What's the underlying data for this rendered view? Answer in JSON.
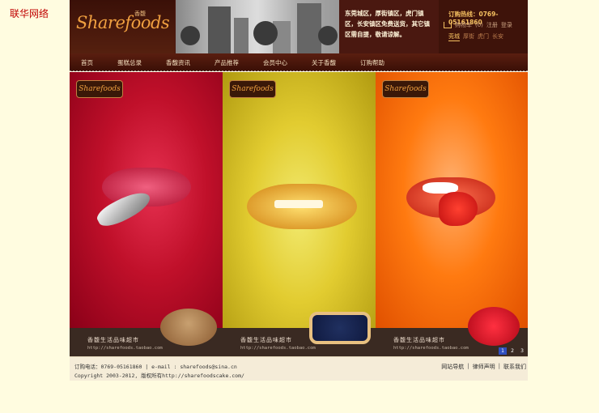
{
  "corner_label": "联华网络",
  "header": {
    "logo": "Sharefoods",
    "logo_cn": "香馥",
    "notice": "东莞城区，厚街镇区，虎门镇区，长安镇区免费送货，其它镇区需自提，敬请谅解。",
    "hotline_label": "订购热线：",
    "hotline": "0769-05161860",
    "cart": "购物车",
    "cart_count": "(0)",
    "register": "注册",
    "login": "登录",
    "cities": [
      "莞城",
      "厚街",
      "虎门",
      "长安"
    ],
    "active_city": "莞城"
  },
  "nav": {
    "items": [
      "首页",
      "蛋糕总录",
      "香馥资讯",
      "产品推荐",
      "会员中心",
      "关于香馥",
      "订购帮助"
    ]
  },
  "banner": {
    "panels": [
      {
        "logo": "Sharefoods",
        "slogan": "香馥生活品味超市",
        "url": "http://sharefoods.taobao.com"
      },
      {
        "logo": "Sharefoods",
        "slogan": "香馥生活品味超市",
        "url": "http://sharefoods.taobao.com"
      },
      {
        "logo": "Sharefoods",
        "slogan": "香馥生活品味超市",
        "url": "http://sharefoods.taobao.com"
      }
    ],
    "pager": [
      "1",
      "2",
      "3"
    ],
    "active_page": 1
  },
  "footer": {
    "line1": "订购电话：0769-05161860  |  e-mail : sharefoods@sina.cn",
    "line2": "Copyright 2003-2012, 版权所有http://sharefoodscake.com/",
    "links": [
      "网站导航",
      "律师声明",
      "联系我们"
    ]
  },
  "colors": {
    "header_bg": "#4a1810",
    "accent_gold": "#f5c060",
    "panel_red": "#c0102a",
    "panel_yellow": "#e2cc30",
    "panel_orange": "#ff7a10",
    "page_bg": "#fffce0"
  }
}
